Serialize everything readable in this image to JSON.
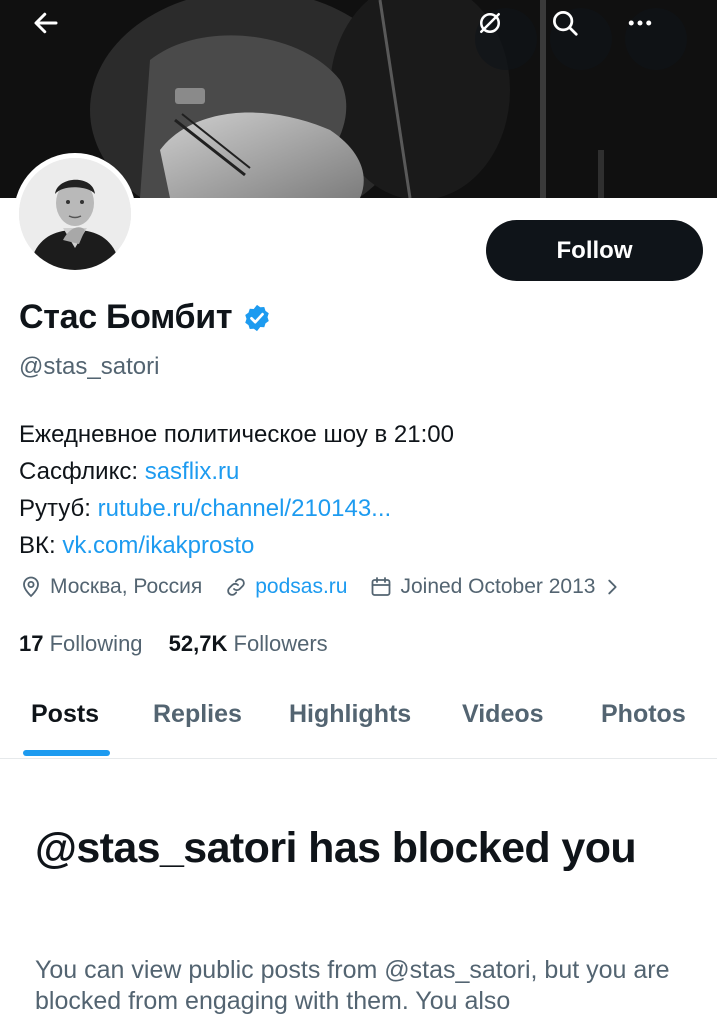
{
  "profile": {
    "display_name": "Стас Бомбит",
    "handle": "@stas_satori",
    "follow_label": "Follow",
    "bio": {
      "line1": "Ежедневное политическое шоу в 21:00",
      "line2_prefix": "Сасфликс: ",
      "line2_link": "sasflix.ru",
      "line3_prefix": "Рутуб: ",
      "line3_link": "rutube.ru/channel/210143...",
      "line4_prefix": "ВК: ",
      "line4_link": "vk.com/ikakprosto"
    },
    "location": "Москва, Россия",
    "website": "podsas.ru",
    "joined": "Joined October 2013",
    "following_count": "17",
    "following_label": "Following",
    "followers_count": "52,7K",
    "followers_label": "Followers"
  },
  "tabs": [
    {
      "label": "Posts",
      "active": true
    },
    {
      "label": "Replies",
      "active": false
    },
    {
      "label": "Highlights",
      "active": false
    },
    {
      "label": "Videos",
      "active": false
    },
    {
      "label": "Photos",
      "active": false
    }
  ],
  "blocked": {
    "title": "@stas_satori has blocked you",
    "text": "You can view public posts from @stas_satori, but you are blocked from engaging with them. You also"
  },
  "icons": {
    "back": "arrow-left-icon",
    "grok": "grok-icon",
    "search": "search-icon",
    "more": "more-icon",
    "verified": "verified-badge-icon",
    "location": "location-pin-icon",
    "link": "link-icon",
    "calendar": "calendar-icon",
    "chevron": "chevron-right-icon"
  },
  "colors": {
    "accent": "#1d9bf0",
    "text": "#0f1419",
    "muted": "#536471",
    "follow_button": "#0f1419"
  }
}
